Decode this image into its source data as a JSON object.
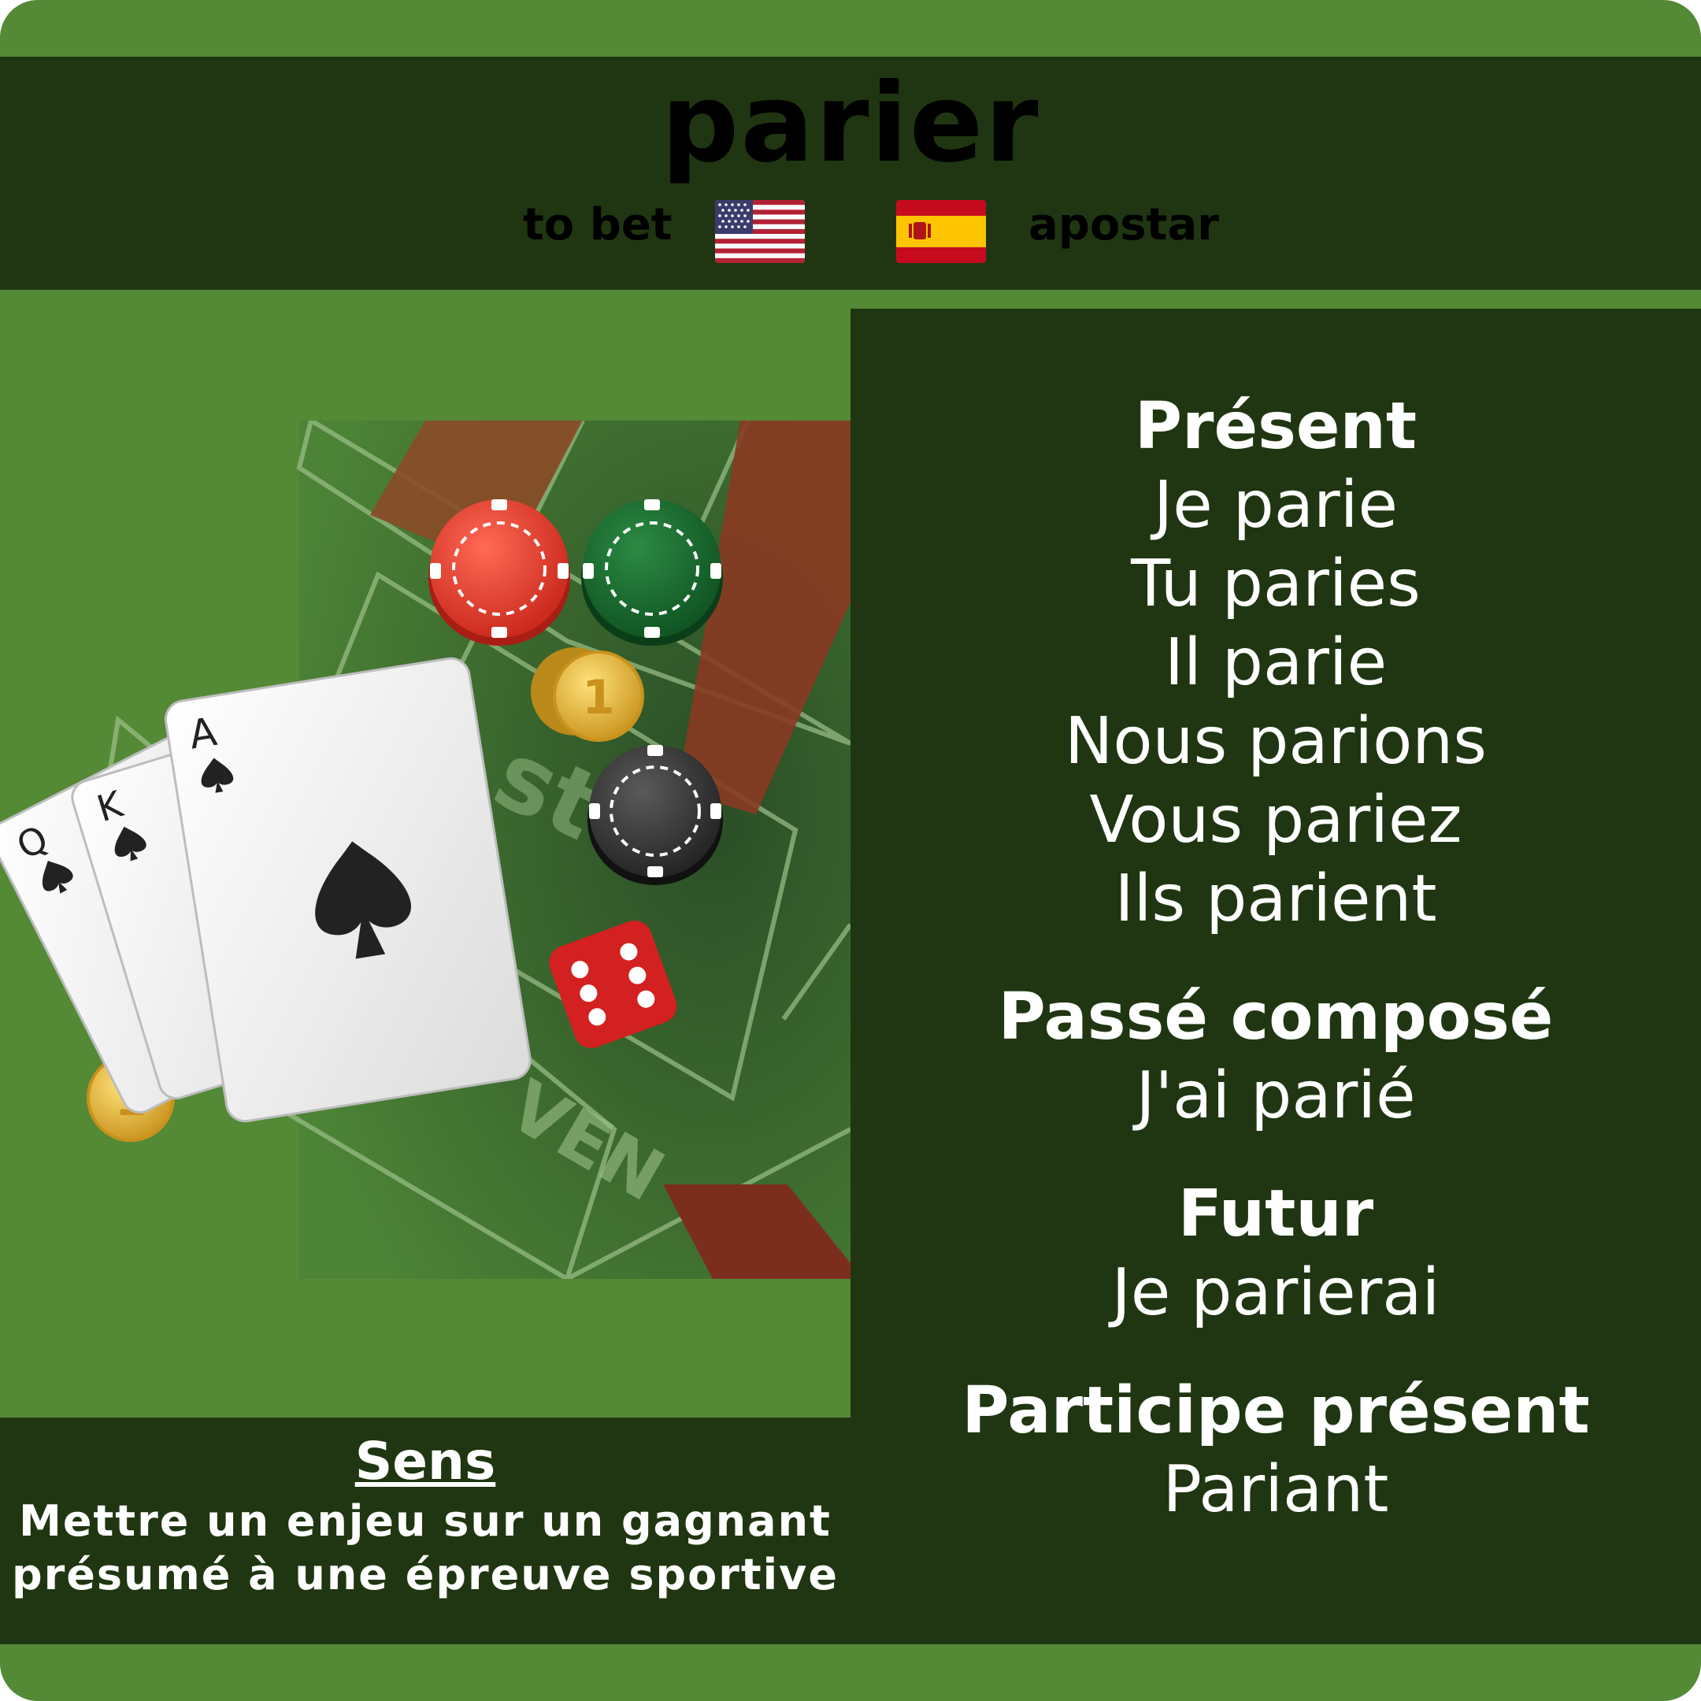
{
  "verb": "parier",
  "translations": {
    "english": "to bet",
    "spanish": "apostar"
  },
  "flags": {
    "english": "us-flag-icon",
    "spanish": "spain-flag-icon"
  },
  "conjugation": {
    "present": {
      "title": "Présent",
      "forms": [
        "Je parie",
        "Tu paries",
        "Il parie",
        "Nous parions",
        "Vous pariez",
        "Ils parient"
      ]
    },
    "passe_compose": {
      "title": "Passé composé",
      "form": "J'ai parié"
    },
    "futur": {
      "title": "Futur",
      "form": "Je parierai"
    },
    "participe_present": {
      "title": "Participe présent",
      "form": "Pariant"
    }
  },
  "sens": {
    "title": "Sens",
    "lines": [
      "Mettre un enjeu sur un gagnant",
      "présumé à une épreuve sportive"
    ]
  },
  "illustration": {
    "icon": "casino-illustration-icon",
    "cards": [
      "Q",
      "K",
      "A"
    ],
    "coin_label": "1",
    "colors": {
      "felt": "#548936",
      "table": "#3e6e2f",
      "red_chip": "#d93a2b",
      "green_chip": "#1a6b2e",
      "black_chip": "#333333",
      "gold": "#e0ae2a"
    }
  },
  "colors": {
    "background": "#548936",
    "panel": "#203612",
    "text": "#ffffff"
  }
}
